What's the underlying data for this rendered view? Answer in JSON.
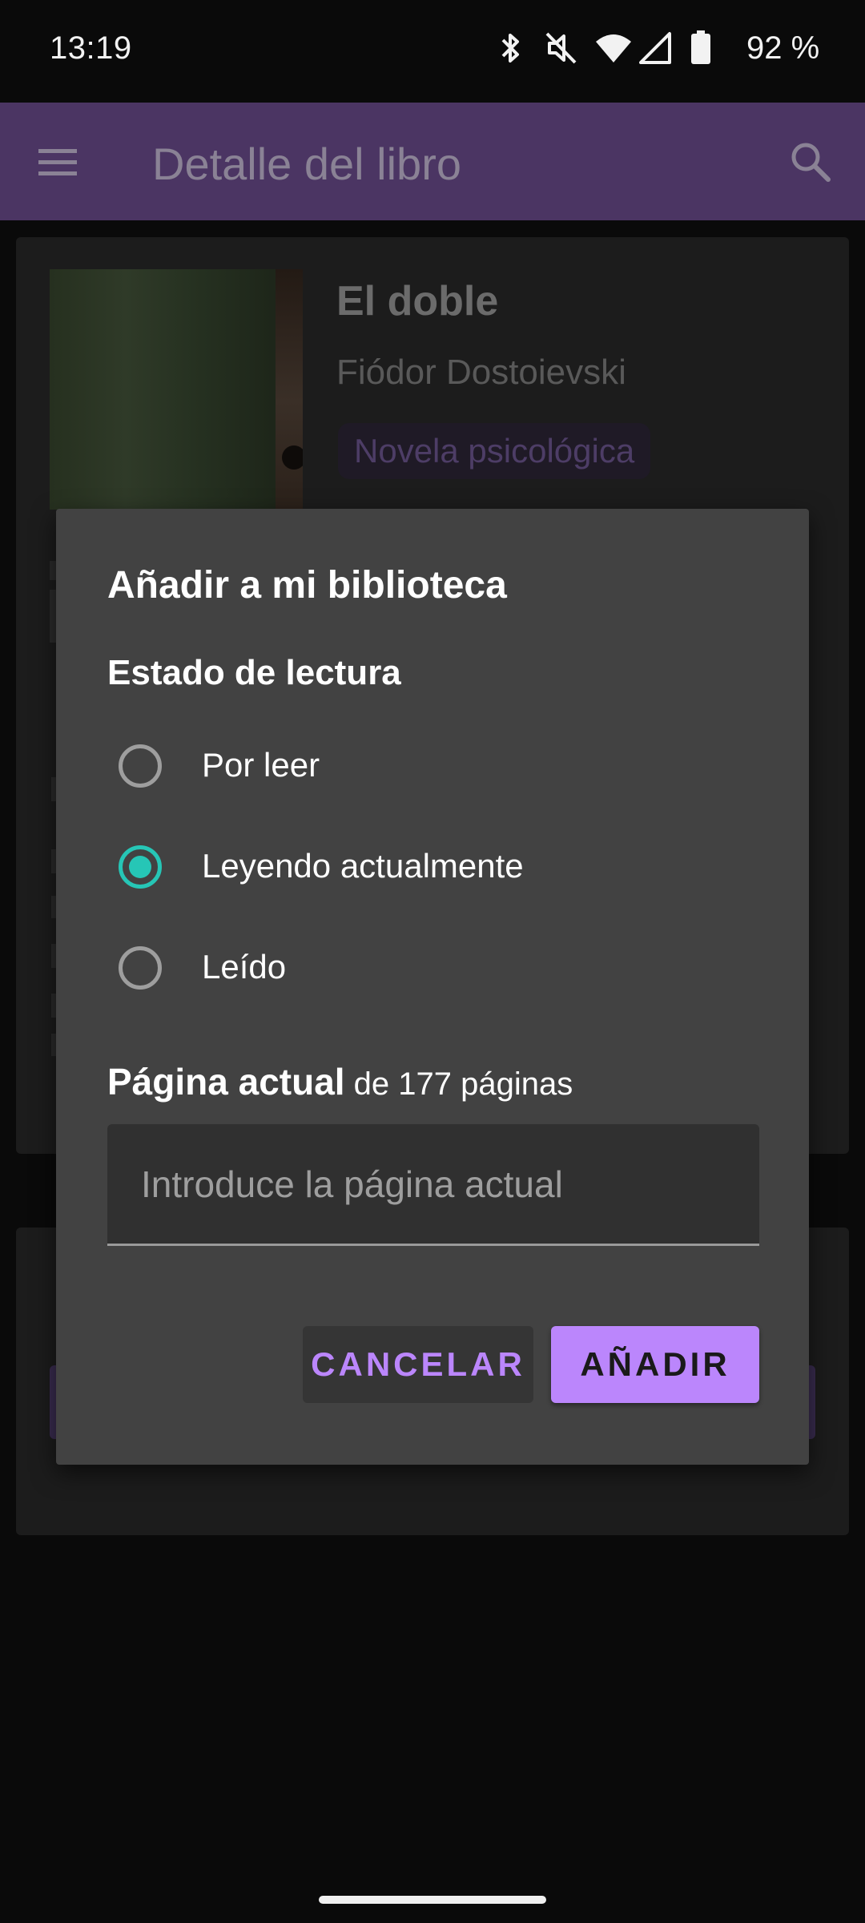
{
  "status_bar": {
    "time": "13:19",
    "battery_text": "92 %",
    "icons": [
      "bluetooth-icon",
      "mute-icon",
      "wifi-icon",
      "signal-icon",
      "battery-icon"
    ]
  },
  "app_bar": {
    "title": "Detalle del libro",
    "menu_icon": "menu-icon",
    "search_icon": "search-icon",
    "color": "#4b3563"
  },
  "book": {
    "title": "El doble",
    "author": "Fiódor Dostoievski",
    "genre": "Novela psicológica"
  },
  "dialog": {
    "title": "Añadir a mi biblioteca",
    "section_label": "Estado de lectura",
    "options": [
      {
        "label": "Por leer",
        "checked": false
      },
      {
        "label": "Leyendo actualmente",
        "checked": true
      },
      {
        "label": "Leído",
        "checked": false
      }
    ],
    "page_label_bold": "Página actual",
    "page_label_rest": " de 177 páginas",
    "page_input_placeholder": "Introduce la página actual",
    "cancel_label": "CANCELAR",
    "add_label": "AÑADIR",
    "accent_color": "#bb86fc",
    "radio_color": "#26c6b6"
  }
}
